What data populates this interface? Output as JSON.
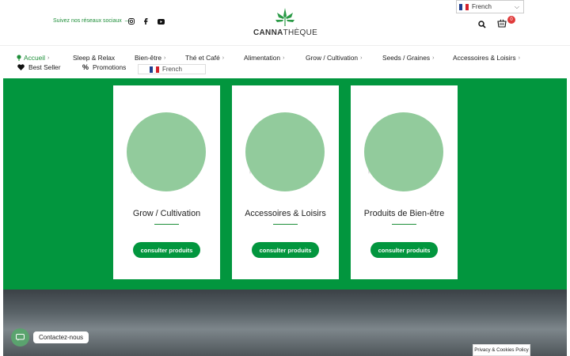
{
  "header": {
    "social_text": "Suivez nos réseaux sociaux",
    "social_dash": "—",
    "logo_text_bold": "CANNA",
    "logo_text_light": "THÈQUE",
    "language_selected": "French",
    "cart_count": "0"
  },
  "nav": {
    "items": [
      {
        "label": "Accueil"
      },
      {
        "label": "Sleep & Relax"
      },
      {
        "label": "Bien-être"
      },
      {
        "label": "Thé et Café"
      },
      {
        "label": "Alimentation"
      },
      {
        "label": "Grow / Cultivation"
      },
      {
        "label": "Seeds / Graines"
      },
      {
        "label": "Accessoires & Loisirs"
      }
    ],
    "best_seller": "Best Seller",
    "promotions": "Promotions",
    "language_option": "French"
  },
  "cards": [
    {
      "title": "Grow / Cultivation",
      "button": "consulter produits"
    },
    {
      "title": "Accessoires & Loisirs",
      "button": "consulter produits"
    },
    {
      "title": "Produits de Bien-être",
      "button": "consulter produits"
    }
  ],
  "footer": {
    "chat_label": "Contactez-nous",
    "cookie_label": "Privacy & Cookies Policy"
  },
  "colors": {
    "brand_green": "#02963e",
    "accent_green": "#1f8f3a",
    "badge_red": "#e03a3a"
  }
}
